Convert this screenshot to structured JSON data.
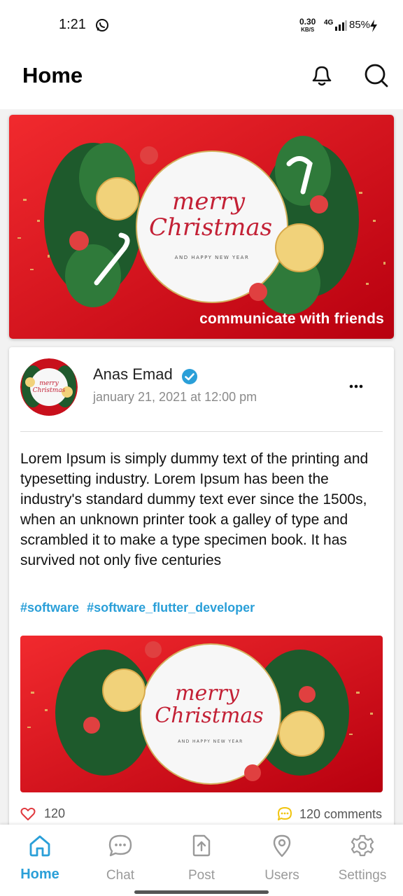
{
  "status_bar": {
    "time": "1:21",
    "net_speed_value": "0.30",
    "net_speed_unit": "KB/S",
    "network_type": "4G",
    "battery": "85%",
    "icons": [
      "whatsapp-icon",
      "signal-icon",
      "charging-bolt-icon"
    ]
  },
  "header": {
    "title": "Home",
    "actions": [
      "bell-icon",
      "search-icon"
    ]
  },
  "banner": {
    "caption": "communicate with friends",
    "image_text_main_1": "merry",
    "image_text_main_2": "Christmas",
    "image_text_sub": "AND HAPPY NEW YEAR"
  },
  "post": {
    "author": "Anas Emad",
    "verified": true,
    "date": "january 21, 2021 at 12:00 pm",
    "text": "Lorem Ipsum is simply dummy text of the printing and typesetting industry. Lorem Ipsum has been the industry's standard dummy text ever since the 1500s, when an unknown printer took a galley of type and scrambled it to make a type specimen book. It has survived not only five centuries",
    "tags": [
      "#software",
      "#software_flutter_developer"
    ],
    "likes": "120",
    "comments": "120 comments"
  },
  "bottom_nav": {
    "items": [
      {
        "label": "Home",
        "icon": "home-icon",
        "active": true
      },
      {
        "label": "Chat",
        "icon": "chat-icon",
        "active": false
      },
      {
        "label": "Post",
        "icon": "upload-post-icon",
        "active": false
      },
      {
        "label": "Users",
        "icon": "location-pin-icon",
        "active": false
      },
      {
        "label": "Settings",
        "icon": "gear-icon",
        "active": false
      }
    ]
  },
  "colors": {
    "accent": "#2a9fd8",
    "banner_red": "#d8121f",
    "like_red": "#e0393e",
    "comment_yellow": "#f1c40f"
  }
}
